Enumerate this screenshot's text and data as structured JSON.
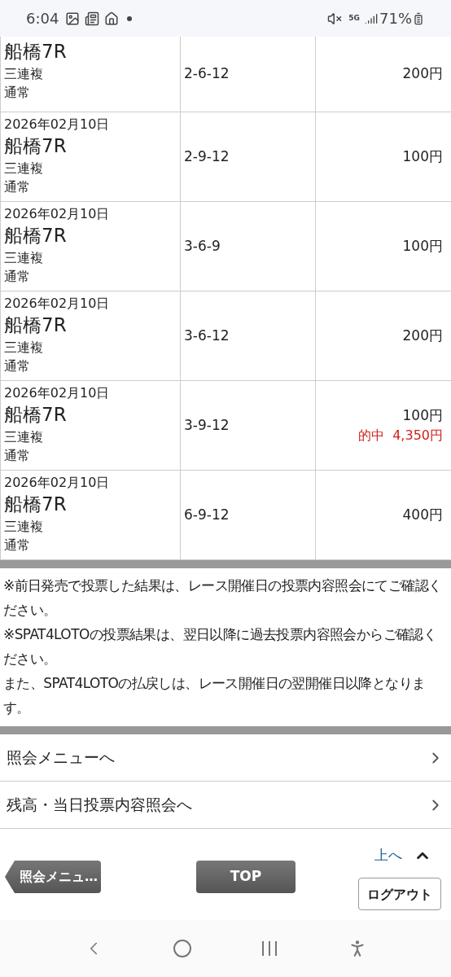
{
  "status_bar": {
    "time": "6:04",
    "network": "5G",
    "battery": "71%"
  },
  "bets": [
    {
      "venue": "船橋7R",
      "bet_type": "三連複",
      "method": "通常",
      "numbers": "2-6-12",
      "amount": "200円"
    },
    {
      "date": "2026年02月10日",
      "venue": "船橋7R",
      "bet_type": "三連複",
      "method": "通常",
      "numbers": "2-9-12",
      "amount": "100円"
    },
    {
      "date": "2026年02月10日",
      "venue": "船橋7R",
      "bet_type": "三連複",
      "method": "通常",
      "numbers": "3-6-9",
      "amount": "100円"
    },
    {
      "date": "2026年02月10日",
      "venue": "船橋7R",
      "bet_type": "三連複",
      "method": "通常",
      "numbers": "3-6-12",
      "amount": "200円"
    },
    {
      "date": "2026年02月10日",
      "venue": "船橋7R",
      "bet_type": "三連複",
      "method": "通常",
      "numbers": "3-9-12",
      "amount": "100円",
      "hit": {
        "label": "的中",
        "payout": "4,350円"
      }
    },
    {
      "date": "2026年02月10日",
      "venue": "船橋7R",
      "bet_type": "三連複",
      "method": "通常",
      "numbers": "6-9-12",
      "amount": "400円"
    }
  ],
  "notes": [
    "※前日発売で投票した結果は、レース開催日の投票内容照会にてご確認ください。",
    "※SPAT4LOTOの投票結果は、翌日以降に過去投票内容照会からご確認ください。",
    "また、SPAT4LOTOの払戻しは、レース開催日の翌開催日以降となります。"
  ],
  "menu_links": [
    "照会メニューへ",
    "残高・当日投票内容照会へ"
  ],
  "footer": {
    "back_button": "照会メニュ…",
    "top_button": "TOP",
    "page_top_link": "上へ",
    "logout_button": "ログアウト"
  }
}
